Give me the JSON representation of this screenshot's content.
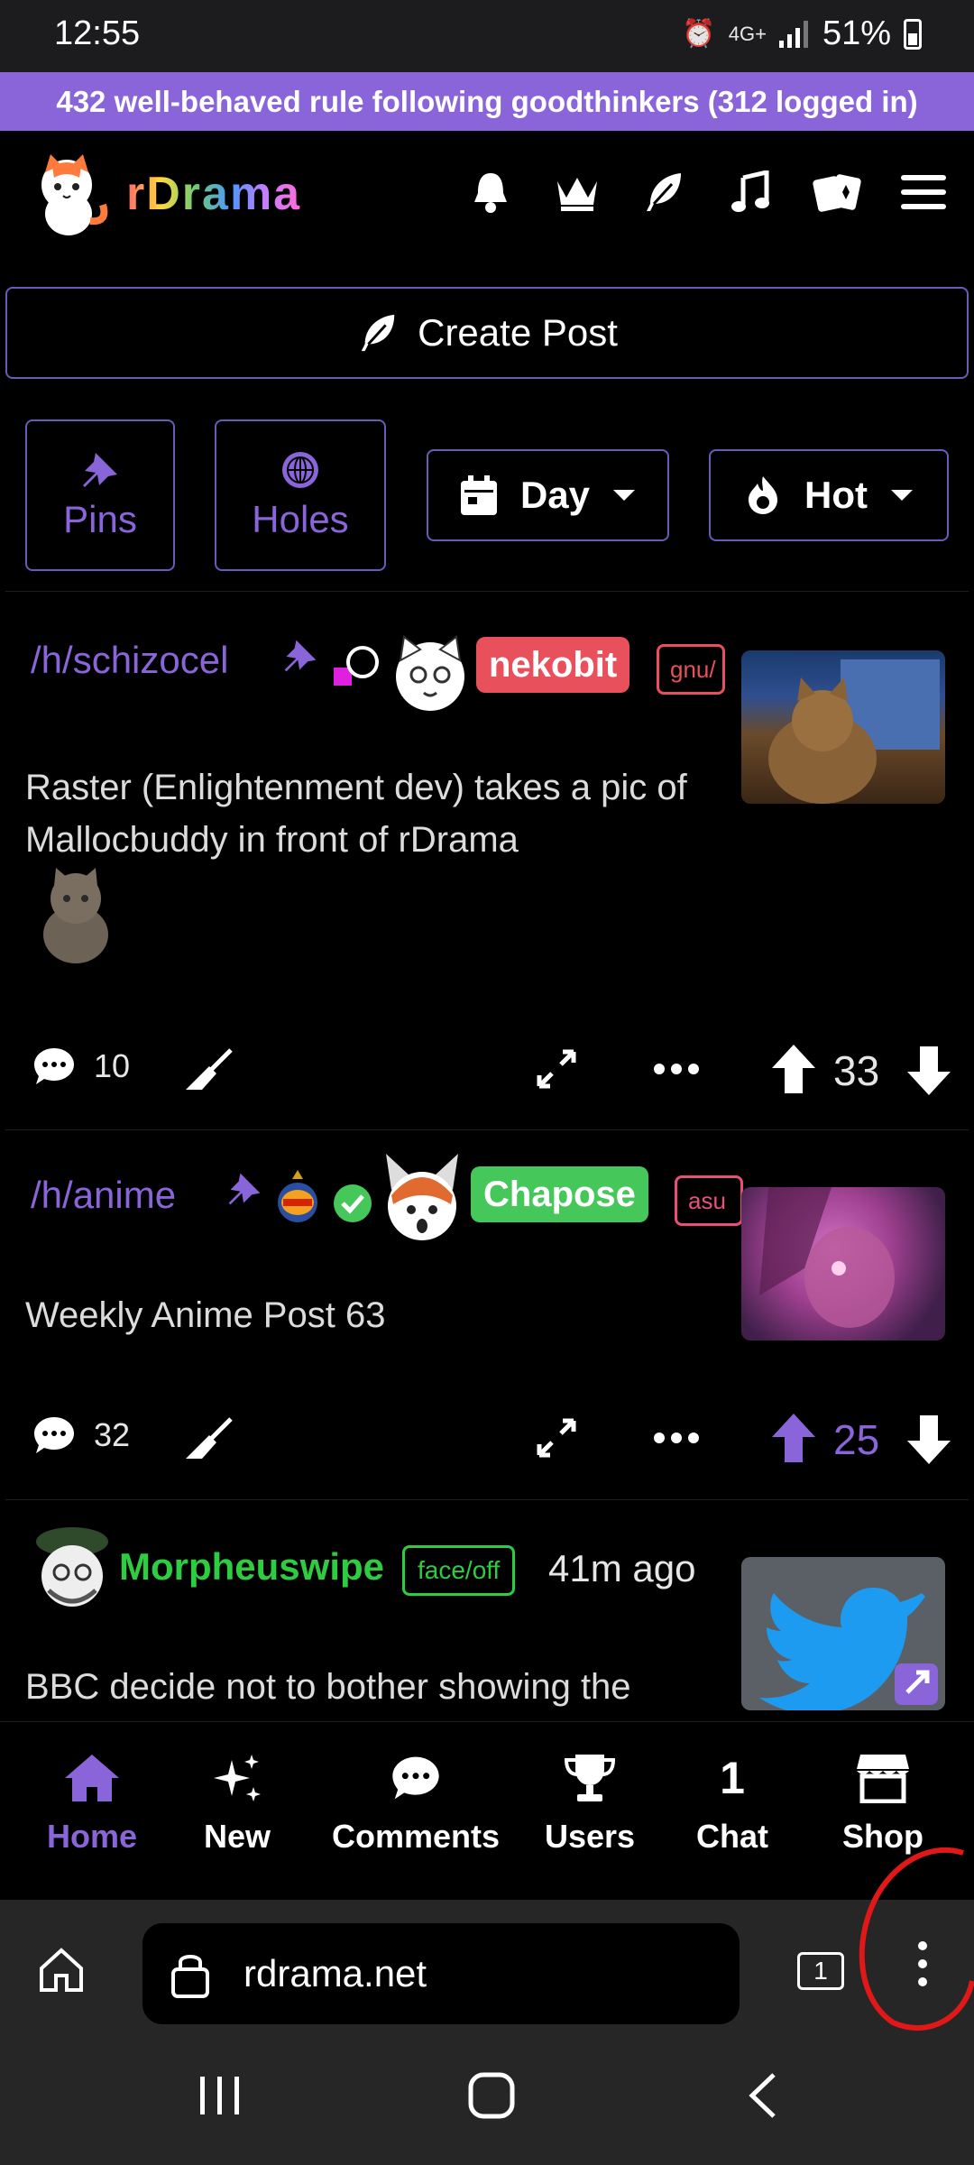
{
  "status_bar": {
    "time": "12:55",
    "network": "4G+",
    "battery": "51%"
  },
  "banner": {
    "text": "432 well-behaved rule following goodthinkers (312 logged in)"
  },
  "header": {
    "site_name": "rDrama",
    "icons": [
      "bell-icon",
      "crown-icon",
      "feather-icon",
      "music-icon",
      "cards-icon",
      "hamburger-menu-icon"
    ]
  },
  "create_post": {
    "label": "Create Post"
  },
  "filters": {
    "pins_label": "Pins",
    "holes_label": "Holes",
    "time_value": "Day",
    "sort_value": "Hot"
  },
  "posts": [
    {
      "hole": "/h/schizocel",
      "author": "nekobit",
      "author_color": "#e8505b",
      "flair": "gnu/",
      "flair_color": "#e8505b",
      "title": "Raster (Enlightenment dev) takes a pic of Mallocbuddy in front of rDrama",
      "comments": "10",
      "score": "33"
    },
    {
      "hole": "/h/anime",
      "author": "Chapose",
      "author_color": "#46c75a",
      "flair": "asu",
      "flair_color": "#e8507a",
      "title": "Weekly Anime Post 63",
      "comments": "32",
      "score": "25"
    },
    {
      "author": "Morpheuswipe",
      "author_color": "#2ecc40",
      "flair": "face/off",
      "flair_color": "#2ecc40",
      "time": "41m ago",
      "title": "BBC decide not to bother showing the"
    }
  ],
  "bottom_nav": {
    "items": [
      {
        "label": "Home"
      },
      {
        "label": "New"
      },
      {
        "label": "Comments"
      },
      {
        "label": "Users"
      },
      {
        "label": "Chat",
        "badge": "1"
      },
      {
        "label": "Shop"
      }
    ]
  },
  "browser": {
    "url": "rdrama.net",
    "tab_count": "1"
  },
  "accent_color": "#8a65d9"
}
